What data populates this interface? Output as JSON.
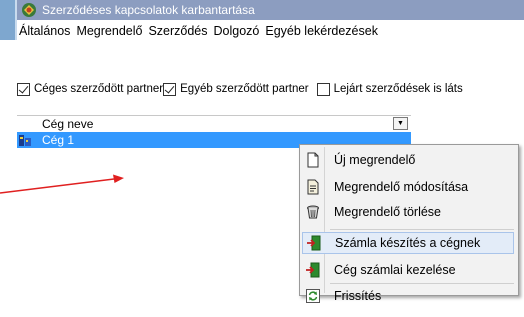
{
  "window": {
    "title": "Szerződéses kapcsolatok karbantartása",
    "icon": "app-icon"
  },
  "menubar": {
    "items": [
      "Általános",
      "Megrendelő",
      "Szerződés",
      "Dolgozó",
      "Egyéb lekérdezések"
    ]
  },
  "filters": [
    {
      "label": "Céges szerződött partner",
      "checked": true
    },
    {
      "label": "Egyéb szerződött partner",
      "checked": true
    },
    {
      "label": "Lejárt szerződések is láts",
      "checked": false
    }
  ],
  "grid": {
    "column_header": "Cég neve",
    "rows": [
      {
        "name": "Cég 1",
        "selected": true
      }
    ]
  },
  "context_menu": {
    "items": [
      {
        "label": "Új megrendelő",
        "icon": "new-document-icon",
        "highlighted": false
      },
      {
        "label": "Megrendelő módosítása",
        "icon": "edit-document-icon",
        "highlighted": false
      },
      {
        "label": "Megrendelő törlése",
        "icon": "trash-bin-icon",
        "highlighted": false
      },
      {
        "label": "Számla készítés a cégnek",
        "icon": "exit-door-icon",
        "highlighted": true
      },
      {
        "label": "Cég számlai kezelése",
        "icon": "exit-door-icon",
        "highlighted": false
      },
      {
        "label": "Frissítés",
        "icon": "refresh-icon",
        "highlighted": false
      }
    ]
  },
  "colors": {
    "titlebar": "#8c9dc0",
    "selection": "#3399ff",
    "menu_highlight": "#e3ecf8",
    "annotation_arrow": "#e02020"
  }
}
